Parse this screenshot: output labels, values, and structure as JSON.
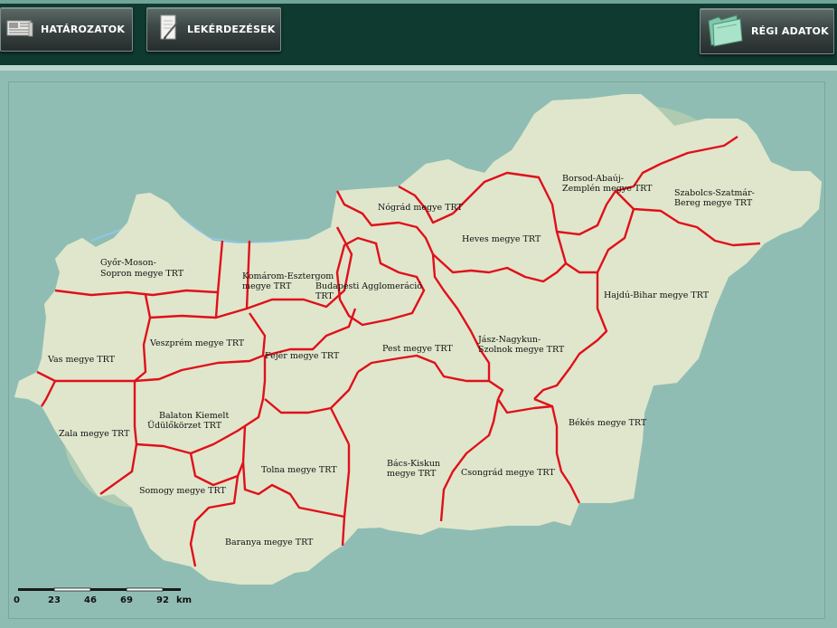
{
  "toolbar": {
    "hatarozatok_label": "HATÁROZATOK",
    "lekerdezesek_label": "LEKÉRDEZÉSEK",
    "regi_adatok_label": "RÉGI ADATOK"
  },
  "map": {
    "country_fill": "#dfe6cc",
    "border_color": "#e0101a",
    "water_color": "#8ec6e8",
    "regions": {
      "gyor": [
        "Győr-Moson-",
        "Sopron megye TRT"
      ],
      "komarom": [
        "Komárom-Esztergom",
        "megye TRT"
      ],
      "budapest": [
        "Budapesti Agglomeráció",
        "TRT"
      ],
      "nograd": [
        "Nógrád megye TRT"
      ],
      "heves": [
        "Heves megye TRT"
      ],
      "borsod": [
        "Borsod-Abaúj-",
        "Zemplén megye TRT"
      ],
      "szabolcs": [
        "Szabolcs-Szatmár-",
        "Bereg megye TRT"
      ],
      "hajdu": [
        "Hajdú-Bihar megye TRT"
      ],
      "vas": [
        "Vas megye TRT"
      ],
      "veszprem": [
        "Veszprém megye TRT"
      ],
      "fejer": [
        "Fejér megye TRT"
      ],
      "pest": [
        "Pest megye TRT"
      ],
      "jasz": [
        "Jász-Nagykun-",
        "Szolnok megye TRT"
      ],
      "balaton": [
        "Balaton Kiemelt",
        "Üdülőkörzet TRT"
      ],
      "zala": [
        "Zala megye TRT"
      ],
      "bekes": [
        "Békés megye TRT"
      ],
      "bacs": [
        "Bács-Kiskun",
        "megye TRT"
      ],
      "tolna": [
        "Tolna megye TRT"
      ],
      "csongrad": [
        "Csongrád megye TRT"
      ],
      "somogy": [
        "Somogy megye TRT"
      ],
      "baranya": [
        "Baranya megye TRT"
      ]
    },
    "scale": {
      "ticks": [
        "0",
        "23",
        "46",
        "69",
        "92"
      ],
      "unit": "km"
    }
  }
}
